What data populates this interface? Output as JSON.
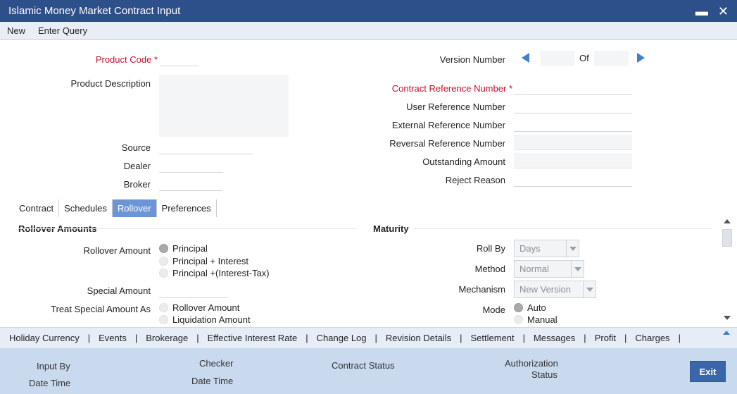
{
  "window": {
    "title": "Islamic Money Market Contract Input",
    "minimize": "▬",
    "close": "✕"
  },
  "menu": {
    "new": "New",
    "enter_query": "Enter Query"
  },
  "header": {
    "product_code_label": "Product Code",
    "required_mark": "*",
    "product_description_label": "Product Description",
    "source_label": "Source",
    "dealer_label": "Dealer",
    "broker_label": "Broker",
    "version_number_label": "Version Number",
    "of_label": "Of",
    "contract_ref_label": "Contract Reference Number",
    "user_ref_label": "User Reference Number",
    "external_ref_label": "External Reference Number",
    "reversal_ref_label": "Reversal Reference Number",
    "outstanding_amount_label": "Outstanding Amount",
    "reject_reason_label": "Reject Reason"
  },
  "tabs": [
    {
      "label": "Contract",
      "active": false
    },
    {
      "label": "Schedules",
      "active": false
    },
    {
      "label": "Rollover",
      "active": true
    },
    {
      "label": "Preferences",
      "active": false
    }
  ],
  "rollover": {
    "section_title": "Rollover Amounts",
    "rollover_amount_label": "Rollover Amount",
    "options": [
      "Principal",
      "Principal + Interest",
      "Principal +(Interest-Tax)"
    ],
    "selected_option": "Principal",
    "special_amount_label": "Special Amount",
    "treat_special_label": "Treat Special Amount As",
    "treat_options": [
      "Rollover Amount",
      "Liquidation Amount"
    ]
  },
  "maturity": {
    "section_title": "Maturity",
    "roll_by_label": "Roll By",
    "roll_by_value": "Days",
    "method_label": "Method",
    "method_value": "Normal",
    "mechanism_label": "Mechanism",
    "mechanism_value": "New Version",
    "mode_label": "Mode",
    "mode_options": [
      "Auto",
      "Manual"
    ],
    "mode_selected": "Auto"
  },
  "links": [
    "Holiday Currency",
    "Events",
    "Brokerage",
    "Effective Interest Rate",
    "Change Log",
    "Revision Details",
    "Settlement",
    "Messages",
    "Profit",
    "Charges"
  ],
  "link_separator": "|",
  "footer": {
    "input_by": "Input By",
    "date_time": "Date Time",
    "checker": "Checker",
    "checker_date_time": "Date Time",
    "contract_status": "Contract Status",
    "authorization": "Authorization",
    "status": "Status",
    "exit": "Exit"
  }
}
